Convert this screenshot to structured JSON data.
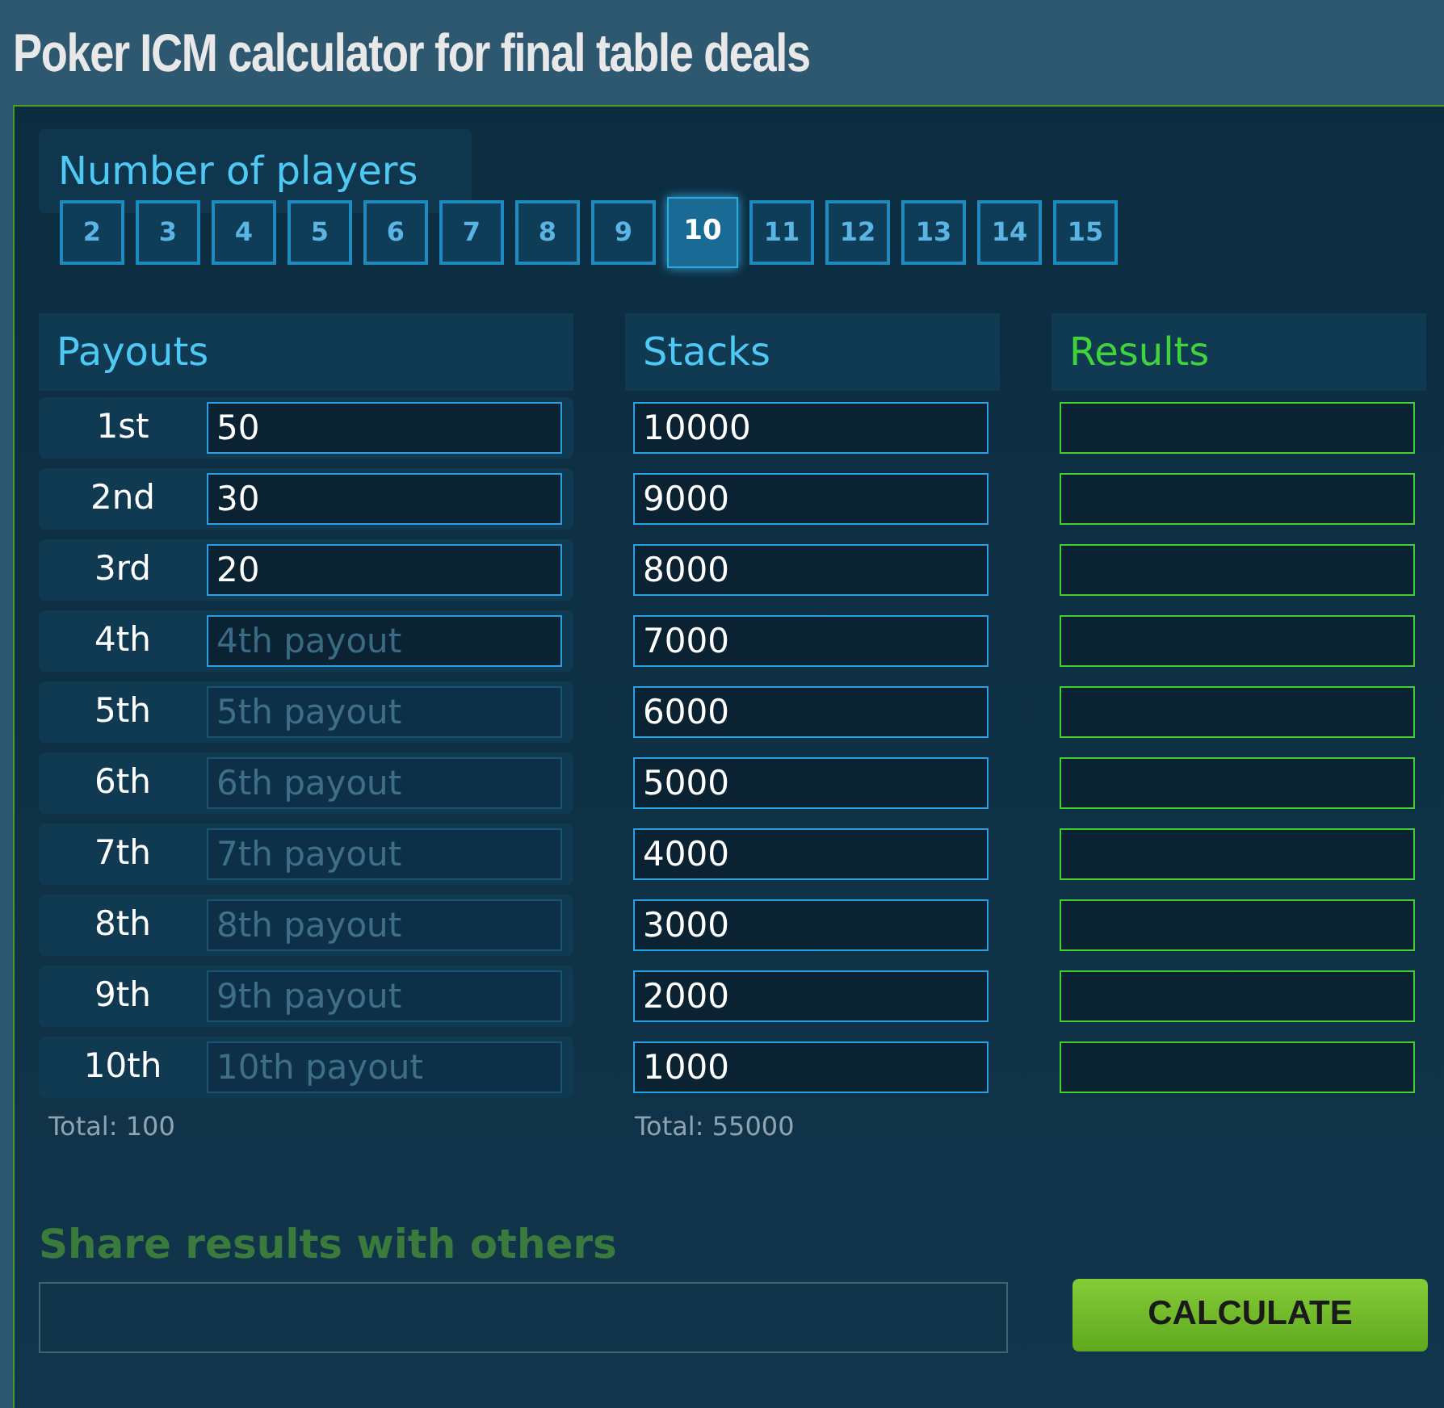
{
  "title": "Poker ICM calculator for final table deals",
  "players": {
    "heading": "Number of players",
    "options": [
      {
        "label": "2",
        "selected": false
      },
      {
        "label": "3",
        "selected": false
      },
      {
        "label": "4",
        "selected": false
      },
      {
        "label": "5",
        "selected": false
      },
      {
        "label": "6",
        "selected": false
      },
      {
        "label": "7",
        "selected": false
      },
      {
        "label": "8",
        "selected": false
      },
      {
        "label": "9",
        "selected": false
      },
      {
        "label": "10",
        "selected": true
      },
      {
        "label": "11",
        "selected": false
      },
      {
        "label": "12",
        "selected": false
      },
      {
        "label": "13",
        "selected": false
      },
      {
        "label": "14",
        "selected": false
      },
      {
        "label": "15",
        "selected": false
      }
    ]
  },
  "payouts": {
    "heading": "Payouts",
    "rows": [
      {
        "place": "1st",
        "value": "50",
        "disabled": false
      },
      {
        "place": "2nd",
        "value": "30",
        "disabled": false
      },
      {
        "place": "3rd",
        "value": "20",
        "disabled": false
      },
      {
        "place": "4th",
        "placeholder": "4th payout",
        "disabled": false
      },
      {
        "place": "5th",
        "placeholder": "5th payout",
        "disabled": true
      },
      {
        "place": "6th",
        "placeholder": "6th payout",
        "disabled": true
      },
      {
        "place": "7th",
        "placeholder": "7th payout",
        "disabled": true
      },
      {
        "place": "8th",
        "placeholder": "8th payout",
        "disabled": true
      },
      {
        "place": "9th",
        "placeholder": "9th payout",
        "disabled": true
      },
      {
        "place": "10th",
        "placeholder": "10th payout",
        "disabled": true
      }
    ],
    "total": "Total: 100"
  },
  "stacks": {
    "heading": "Stacks",
    "values": [
      "10000",
      "9000",
      "8000",
      "7000",
      "6000",
      "5000",
      "4000",
      "3000",
      "2000",
      "1000"
    ],
    "total": "Total: 55000"
  },
  "results": {
    "heading": "Results"
  },
  "share": {
    "heading": "Share results with others"
  },
  "calculate_button": "CALCULATE"
}
